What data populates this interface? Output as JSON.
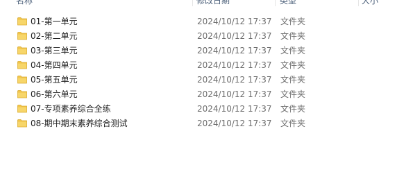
{
  "columns": {
    "name": "名称",
    "date": "修改日期",
    "type": "类型",
    "size": "大小"
  },
  "folder_icon": "folder-icon",
  "folder_color": "#f2c54b",
  "rows": [
    {
      "name": "01-第一单元",
      "date": "2024/10/12 17:37",
      "type": "文件夹"
    },
    {
      "name": "02-第二单元",
      "date": "2024/10/12 17:37",
      "type": "文件夹"
    },
    {
      "name": "03-第三单元",
      "date": "2024/10/12 17:37",
      "type": "文件夹"
    },
    {
      "name": "04-第四单元",
      "date": "2024/10/12 17:37",
      "type": "文件夹"
    },
    {
      "name": "05-第五单元",
      "date": "2024/10/12 17:37",
      "type": "文件夹"
    },
    {
      "name": "06-第六单元",
      "date": "2024/10/12 17:37",
      "type": "文件夹"
    },
    {
      "name": "07-专项素养综合全练",
      "date": "2024/10/12 17:37",
      "type": "文件夹"
    },
    {
      "name": "08-期中期末素养综合测试",
      "date": "2024/10/12 17:37",
      "type": "文件夹"
    }
  ]
}
